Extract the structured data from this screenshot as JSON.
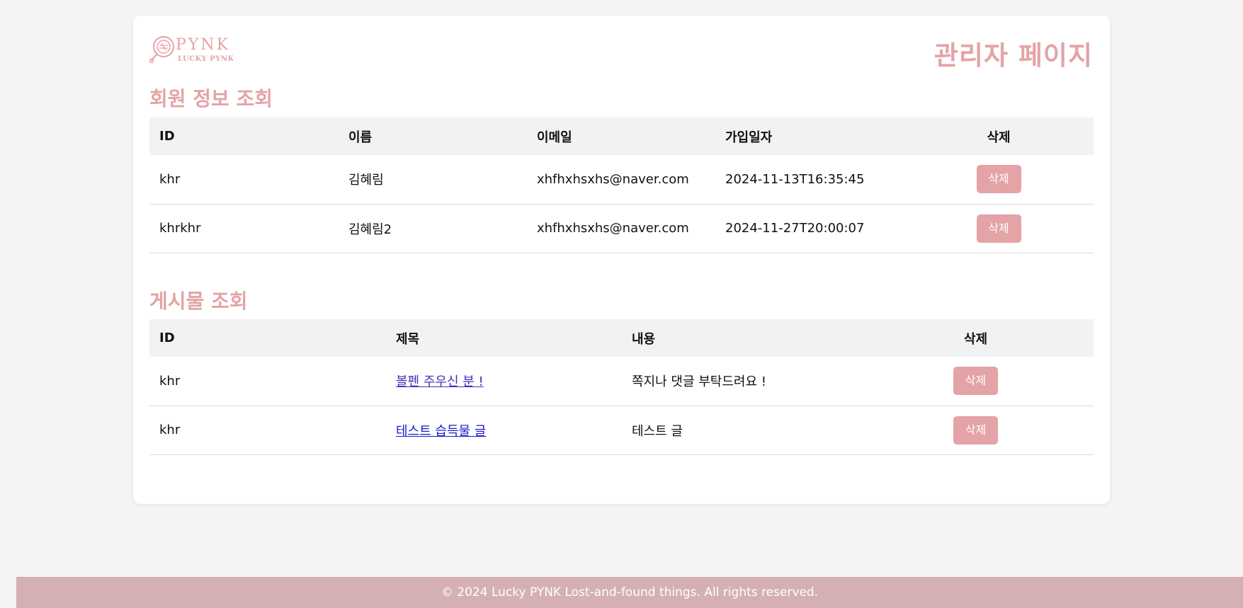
{
  "header": {
    "logo_text": "PYNK",
    "logo_sub": "LUCKY PYNK",
    "page_title": "관리자 페이지"
  },
  "members": {
    "section_title": "회원 정보 조회",
    "columns": [
      "ID",
      "이름",
      "이메일",
      "가입일자",
      "삭제"
    ],
    "rows": [
      {
        "id": "khr",
        "name": "김혜림",
        "email": "xhfhxhsxhs@naver.com",
        "joined": "2024-11-13T16:35:45",
        "delete_label": "삭제"
      },
      {
        "id": "khrkhr",
        "name": "김혜림2",
        "email": "xhfhxhsxhs@naver.com",
        "joined": "2024-11-27T20:00:07",
        "delete_label": "삭제"
      }
    ]
  },
  "posts": {
    "section_title": "게시물 조회",
    "columns": [
      "ID",
      "제목",
      "내용",
      "삭제"
    ],
    "rows": [
      {
        "id": "khr",
        "title": "볼펜 주우신 분 !",
        "content": "쪽지나 댓글 부탁드려요 !",
        "delete_label": "삭제"
      },
      {
        "id": "khr",
        "title": "테스트 습득물 글",
        "content": "테스트 글",
        "delete_label": "삭제"
      }
    ]
  },
  "footer": {
    "text": "© 2024 Lucky PYNK Lost-and-found things. All rights reserved."
  },
  "colors": {
    "accent": "#e4a3a6",
    "footer_bg": "#d4b0b4",
    "page_bg": "#f4f4f4"
  }
}
